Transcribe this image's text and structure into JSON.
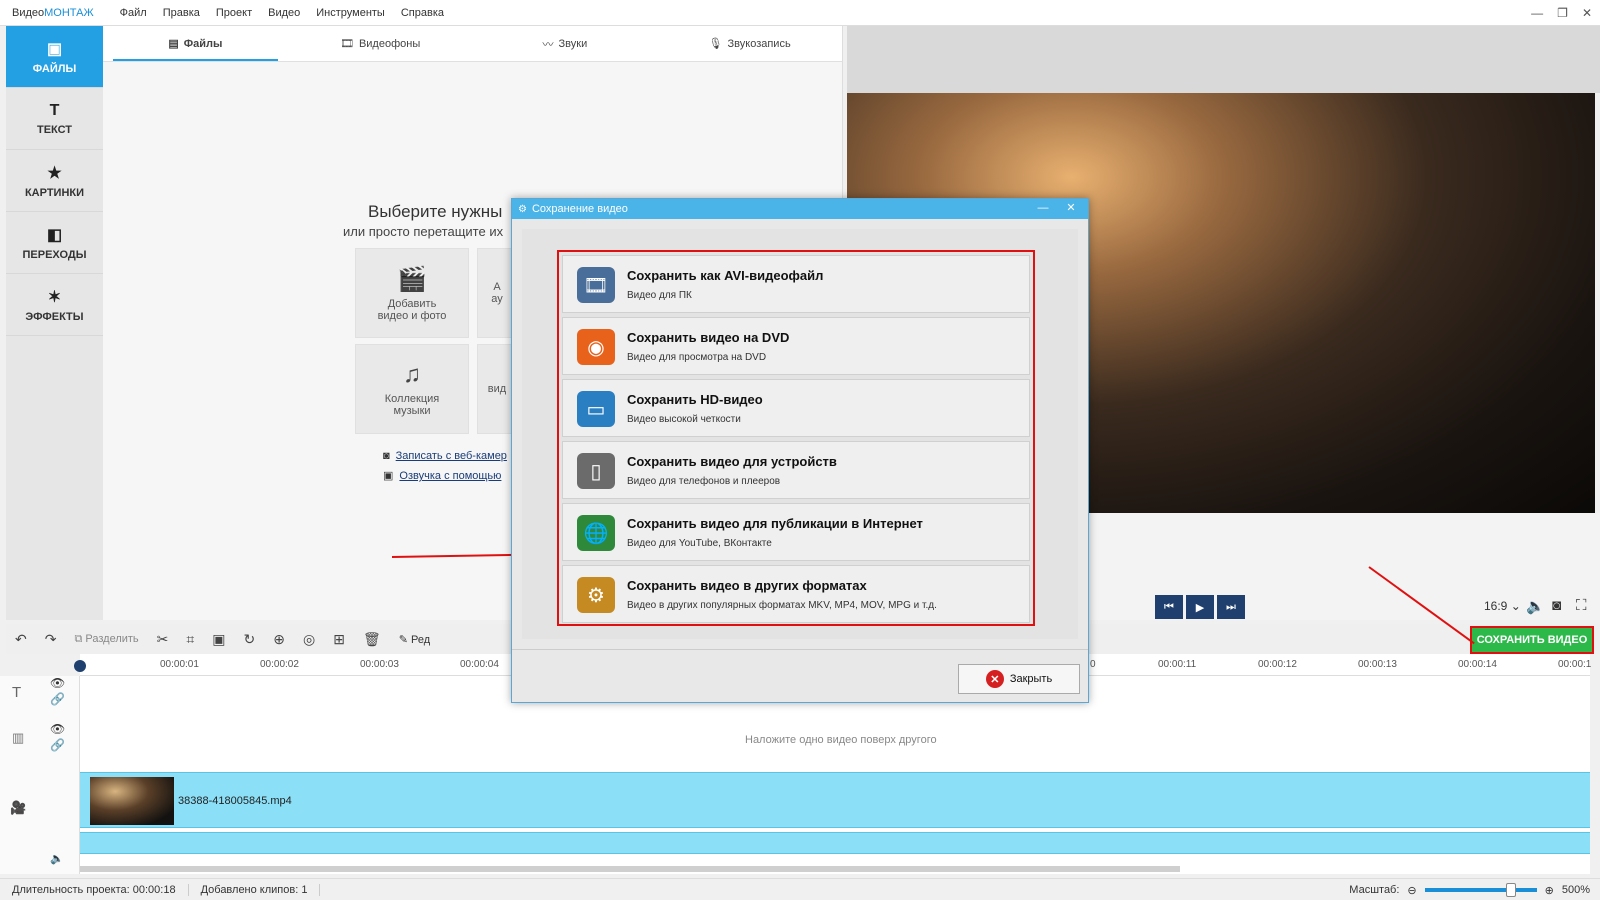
{
  "app": {
    "title_prefix": "Видео",
    "title_brand": "МОНТАЖ"
  },
  "menu": [
    "Файл",
    "Правка",
    "Проект",
    "Видео",
    "Инструменты",
    "Справка"
  ],
  "sidebar": {
    "items": [
      {
        "label": "ФАЙЛЫ",
        "icon": "image-icon",
        "glyph": "▣"
      },
      {
        "label": "ТЕКСТ",
        "icon": "text-icon",
        "glyph": "T"
      },
      {
        "label": "КАРТИНКИ",
        "icon": "star-icon",
        "glyph": "★"
      },
      {
        "label": "ПЕРЕХОДЫ",
        "icon": "transitions-icon",
        "glyph": "◧"
      },
      {
        "label": "ЭФФЕКТЫ",
        "icon": "magic-wand-icon",
        "glyph": "✶"
      }
    ]
  },
  "tabs": [
    {
      "label": "Файлы",
      "glyph": "▤"
    },
    {
      "label": "Видеофоны",
      "glyph": "🎞"
    },
    {
      "label": "Звуки",
      "glyph": "〰"
    },
    {
      "label": "Звукозапись",
      "glyph": "🎙"
    }
  ],
  "files": {
    "prompt_title": "Выберите нужны",
    "prompt_sub": "или просто перетащите их",
    "tiles": [
      {
        "label1": "Добавить",
        "label2": "видео и фото",
        "glyph": "🎬"
      },
      {
        "label1": "А",
        "label2": "ау",
        "glyph": ""
      },
      {
        "label1": "Коллекция",
        "label2": "музыки",
        "glyph": "♫"
      },
      {
        "label1": "",
        "label2": "вид",
        "glyph": ""
      }
    ],
    "links": [
      "Записать с веб-камер",
      "Озвучка с помощью"
    ]
  },
  "preview": {
    "ratio": "16:9 ⌄"
  },
  "toolbar": {
    "split_label": "Разделить",
    "edit_label": "Ред",
    "save_video": "СОХРАНИТЬ ВИДЕО"
  },
  "timeline": {
    "ticks_left": [
      "00:00:01",
      "00:00:02",
      "00:00:03",
      "00:00:04"
    ],
    "ticks_right": [
      "0",
      "00:00:11",
      "00:00:12",
      "00:00:13",
      "00:00:14",
      "00:00:1"
    ],
    "overlay_hint": "Наложите одно видео поверх другого",
    "clip_name": "38388-418005845.mp4"
  },
  "status": {
    "duration_label": "Длительность проекта:",
    "duration_value": "00:00:18",
    "clips": "Добавлено клипов: 1",
    "zoom_label": "Масштаб:",
    "zoom_value": "500%",
    "zoom_fraction": 0.8
  },
  "dialog": {
    "title": "Сохранение видео",
    "options": [
      {
        "title": "Сохранить как AVI-видеофайл",
        "subtitle": "Видео для ПК",
        "icon": "film-reel-icon",
        "color": "#4a6e9a",
        "glyph": "🎞"
      },
      {
        "title": "Сохранить видео на DVD",
        "subtitle": "Видео для просмотра на DVD",
        "icon": "dvd-disc-icon",
        "color": "#e8621c",
        "glyph": "◉"
      },
      {
        "title": "Сохранить HD-видео",
        "subtitle": "Видео высокой четкости",
        "icon": "monitor-icon",
        "color": "#2a7fc2",
        "glyph": "▭"
      },
      {
        "title": "Сохранить видео для устройств",
        "subtitle": "Видео для телефонов и плееров",
        "icon": "phone-icon",
        "color": "#6b6b6b",
        "glyph": "▯"
      },
      {
        "title": "Сохранить видео для публикации в Интернет",
        "subtitle": "Видео для YouTube, ВКонтакте",
        "icon": "globe-icon",
        "color": "#2e8a3a",
        "glyph": "🌐"
      },
      {
        "title": "Сохранить видео в других форматах",
        "subtitle": "Видео в других популярных форматах MKV, MP4, MOV, MPG и т.д.",
        "icon": "file-reel-icon",
        "color": "#c58a22",
        "glyph": "⚙"
      }
    ],
    "close_label": "Закрыть"
  }
}
